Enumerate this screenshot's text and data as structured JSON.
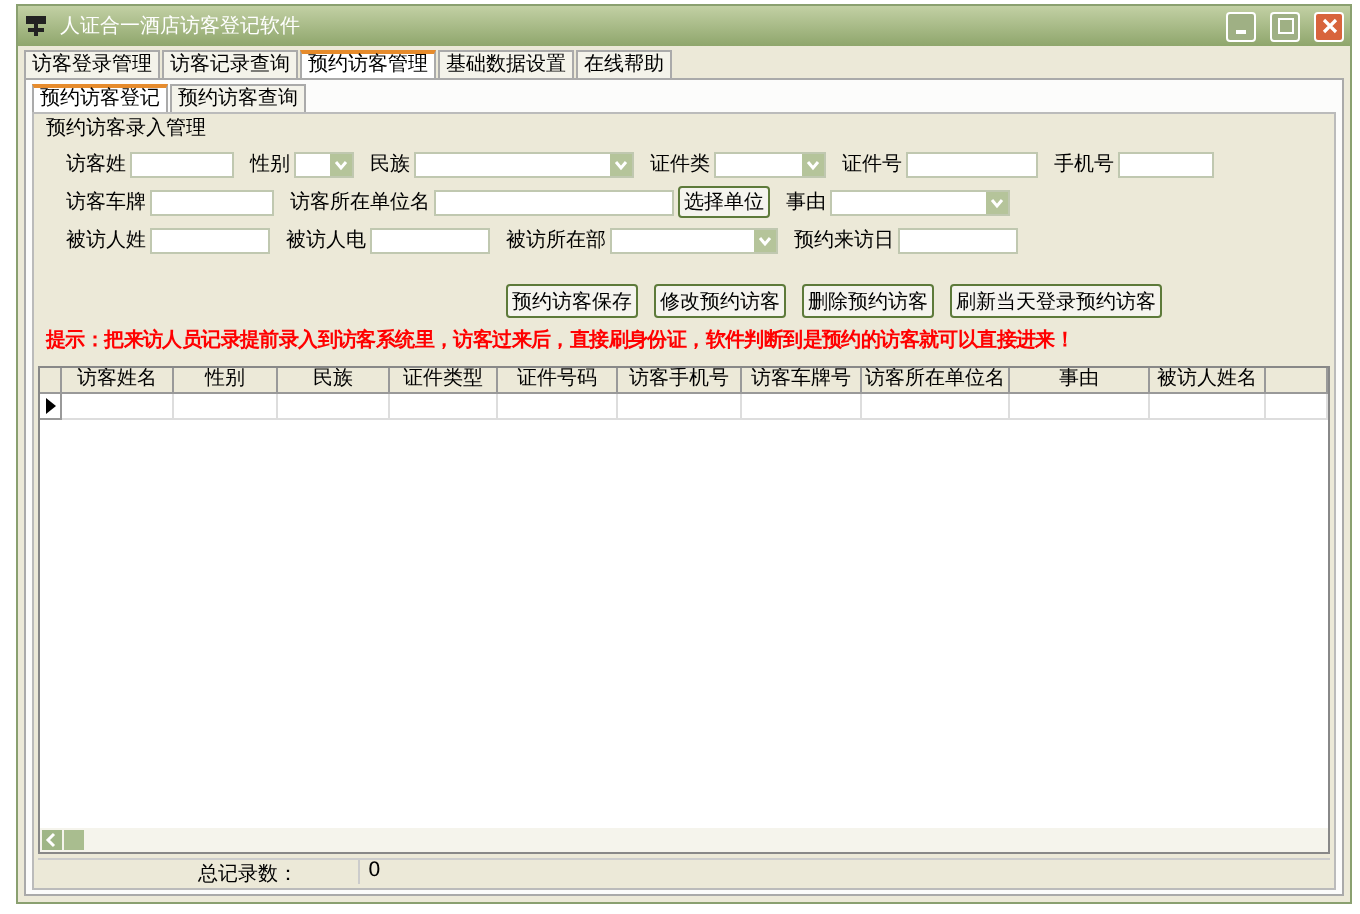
{
  "window": {
    "title": "人证合一酒店访客登记软件"
  },
  "menu_tabs": [
    {
      "label": "访客登录管理",
      "selected": false
    },
    {
      "label": "访客记录查询",
      "selected": false
    },
    {
      "label": "预约访客管理",
      "selected": true
    },
    {
      "label": "基础数据设置",
      "selected": false
    },
    {
      "label": "在线帮助",
      "selected": false
    }
  ],
  "sub_tabs": [
    {
      "label": "预约访客登记",
      "selected": true
    },
    {
      "label": "预约访客查询",
      "selected": false
    }
  ],
  "group": {
    "title": "预约访客录入管理"
  },
  "form_rows": [
    [
      {
        "kind": "text",
        "label": "访客姓"
      },
      {
        "kind": "select",
        "label": "性别"
      },
      {
        "kind": "select",
        "label": "民族"
      },
      {
        "kind": "select",
        "label": "证件类"
      },
      {
        "kind": "text",
        "label": "证件号"
      },
      {
        "kind": "text",
        "label": "手机号"
      }
    ],
    [
      {
        "kind": "text",
        "label": "访客车牌"
      },
      {
        "kind": "text",
        "label": "访客所在单位名"
      },
      {
        "kind": "button",
        "label": "选择单位"
      },
      {
        "kind": "select",
        "label": "事由"
      }
    ],
    [
      {
        "kind": "text",
        "label": "被访人姓"
      },
      {
        "kind": "text",
        "label": "被访人电"
      },
      {
        "kind": "select",
        "label": "被访所在部"
      },
      {
        "kind": "text",
        "label": "预约来访日"
      }
    ]
  ],
  "buttons": [
    "预约访客保存",
    "修改预约访客",
    "删除预约访客",
    "刷新当天登录预约访客"
  ],
  "tip": "提示：把来访人员记录提前录入到访客系统里，访客过来后，直接刷身份证，软件判断到是预约的访客就可以直接进来！",
  "table": {
    "columns": [
      "访客姓名",
      "性别",
      "民族",
      "证件类型",
      "证件号码",
      "访客手机号",
      "访客车牌号",
      "访客所在单位名",
      "事由",
      "被访人姓名"
    ]
  },
  "status_bar": {
    "label": "总记录数：",
    "value": "0"
  }
}
